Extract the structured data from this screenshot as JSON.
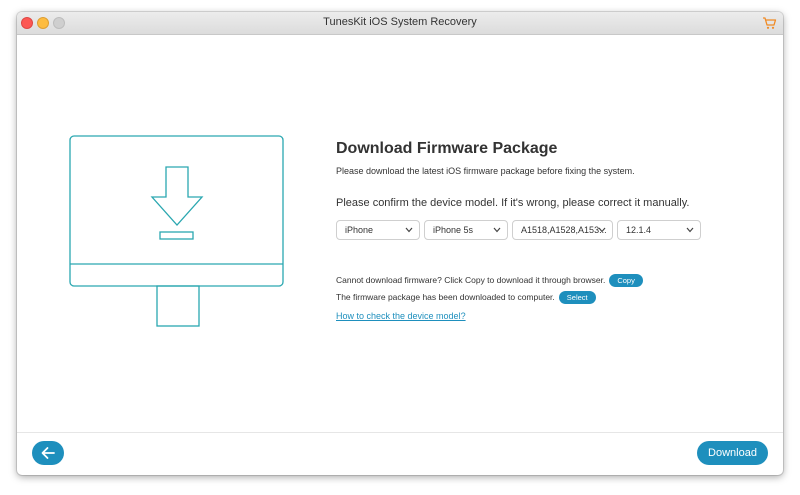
{
  "window": {
    "title": "TunesKit iOS System Recovery"
  },
  "main": {
    "heading": "Download Firmware Package",
    "subtitle": "Please download the latest iOS firmware package before fixing the system.",
    "confirm_text": "Please confirm the device model. If it's wrong, please correct it manually.",
    "selects": [
      {
        "value": "iPhone"
      },
      {
        "value": "iPhone 5s"
      },
      {
        "value": "A1518,A1528,A153..."
      },
      {
        "value": "12.1.4"
      }
    ],
    "copy_line": {
      "text": "Cannot download firmware? Click Copy to download it through browser.",
      "button": "Copy"
    },
    "select_line": {
      "text": "The firmware package has been downloaded to computer.",
      "button": "Select"
    },
    "help_link": "How to check the device model?"
  },
  "footer": {
    "download_label": "Download"
  },
  "colors": {
    "accent": "#1e8fbd",
    "illustration": "#2aa7b0"
  },
  "icons": {
    "back": "arrow-left-icon",
    "cart": "cart-icon",
    "chevron": "chevron-down-icon"
  }
}
